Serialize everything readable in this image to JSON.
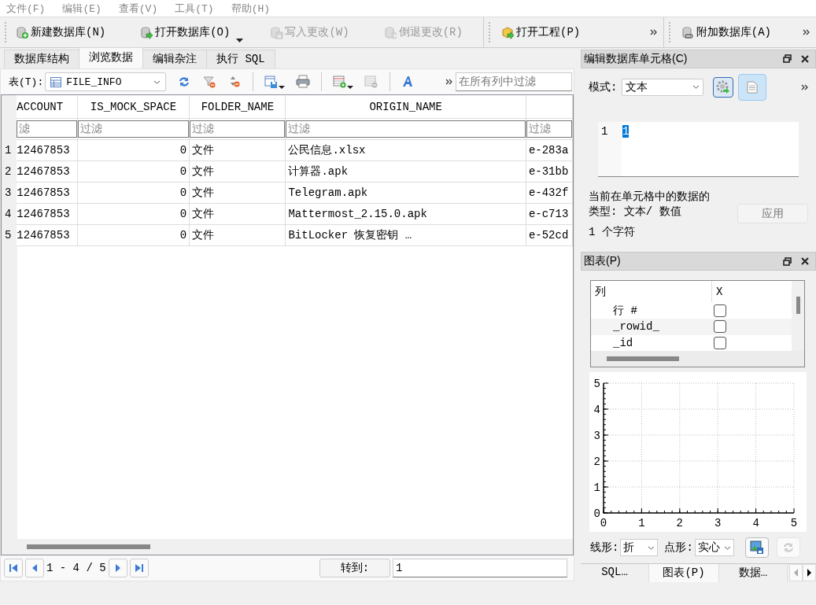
{
  "menu": [
    {
      "label": "文件(F)"
    },
    {
      "label": "编辑(E)"
    },
    {
      "label": "查看(V)"
    },
    {
      "label": "工具(T)"
    },
    {
      "label": "帮助(H)"
    }
  ],
  "toolbars": [
    {
      "items": [
        {
          "label": "新建数据库(N)",
          "disabled": false,
          "dropdown": false
        },
        {
          "label": "打开数据库(O)",
          "disabled": false,
          "dropdown": true
        },
        {
          "label": "写入更改(W)",
          "disabled": true,
          "dropdown": false
        },
        {
          "label": "倒退更改(R)",
          "disabled": true,
          "dropdown": false
        }
      ]
    },
    {
      "items": [
        {
          "label": "打开工程(P)",
          "disabled": false,
          "dropdown": false
        }
      ]
    },
    {
      "items": [
        {
          "label": "附加数据库(A)",
          "disabled": false,
          "dropdown": false
        }
      ]
    }
  ],
  "tabs": [
    {
      "label": "数据库结构",
      "selected": false
    },
    {
      "label": "浏览数据",
      "selected": true
    },
    {
      "label": "编辑杂注",
      "selected": false
    },
    {
      "label": "执行 SQL",
      "selected": false
    }
  ],
  "browse": {
    "table_label": "表(T):",
    "table": "FILE_INFO",
    "filter_placeholder": "在所有列中过滤",
    "columns": [
      {
        "title": "ACCOUNT",
        "placeholder": "滤"
      },
      {
        "title": "IS_MOCK_SPACE",
        "placeholder": "过滤"
      },
      {
        "title": "FOLDER_NAME",
        "placeholder": "过滤"
      },
      {
        "title": "ORIGIN_NAME",
        "placeholder": "过滤"
      },
      {
        "placeholder": "过滤"
      }
    ],
    "rows": [
      {
        "number": "1",
        "cells": [
          "12467853",
          "0",
          "文件",
          "公民信息.xlsx",
          "e-283a"
        ]
      },
      {
        "number": "2",
        "cells": [
          "12467853",
          "0",
          "文件",
          "计算器.apk",
          "e-31bb"
        ]
      },
      {
        "number": "3",
        "cells": [
          "12467853",
          "0",
          "文件",
          "Telegram.apk",
          "e-432f"
        ]
      },
      {
        "number": "4",
        "cells": [
          "12467853",
          "0",
          "文件",
          "Mattermost_2.15.0.apk",
          "e-c713"
        ]
      },
      {
        "number": "5",
        "cells": [
          "12467853",
          "0",
          "文件",
          "BitLocker 恢复密钥 …",
          "e-52cd"
        ]
      }
    ],
    "pagination": {
      "range": "1 - 4 / 5",
      "goto_label": "转到:",
      "goto_value": "1"
    }
  },
  "cell_editor": {
    "title": "编辑数据库单元格(C)",
    "mode_label": "模式:",
    "mode": "文本",
    "auto_switch_on": true,
    "text_mode_on": true,
    "line_number": "1",
    "value": "1",
    "type_info": "当前在单元格中的数据的类型: 文本/ 数值",
    "char_count": "1 个字符",
    "apply": "应用",
    "apply_disabled": true
  },
  "chart": {
    "title": "图表(P)",
    "columns_header": "列",
    "x_header": "X",
    "columns": [
      {
        "name": "行 #",
        "checked": false
      },
      {
        "name": "_rowid_",
        "checked": false
      },
      {
        "name": "_id",
        "checked": false
      }
    ],
    "chart_data": {
      "type": "line",
      "xlim": [
        0,
        5
      ],
      "ylim": [
        0,
        5
      ],
      "xticks": [
        0,
        1,
        2,
        3,
        4,
        5
      ],
      "yticks": [
        0,
        1,
        2,
        3,
        4,
        5
      ],
      "grid": true
    },
    "line_label": "线形:",
    "line_type": "折",
    "point_label": "点形:",
    "point_type": "实心"
  },
  "dock_tabs": [
    {
      "label": "SQL…",
      "selected": false
    },
    {
      "label": "图表(P)",
      "selected": true
    },
    {
      "label": "数据…",
      "selected": false
    }
  ]
}
